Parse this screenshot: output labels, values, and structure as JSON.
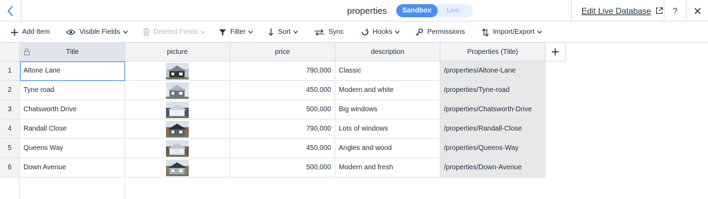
{
  "top_bar": {
    "collection_name": "properties",
    "mode_active": "Sandbox",
    "mode_inactive": "Live",
    "edit_live_label": "Edit Live Database",
    "help_label": "?"
  },
  "toolbar": {
    "add_item": "Add Item",
    "visible_fields": "Visible Fields",
    "deleted_fields": "Deleted Fields",
    "filter": "Filter",
    "sort": "Sort",
    "sync": "Sync",
    "hooks": "Hooks",
    "permissions": "Permissions",
    "import_export": "Import/Export"
  },
  "table": {
    "columns": [
      "Title",
      "picture",
      "price",
      "description",
      "Properties (Title)"
    ],
    "rows": [
      {
        "num": "1",
        "title": "Altone Lane",
        "thumb": "house-photo",
        "price": "790,000",
        "description": "Classic",
        "slug": "/properties/Altone-Lane"
      },
      {
        "num": "2",
        "title": "Tyne road",
        "thumb": "house-photo",
        "price": "450,000",
        "description": "Modern and white",
        "slug": "/properties/Tyne-road"
      },
      {
        "num": "3",
        "title": "Chatsworth Drive",
        "thumb": "house-photo",
        "price": "500,000",
        "description": "Big windows",
        "slug": "/properties/Chatsworth-Drive"
      },
      {
        "num": "4",
        "title": "Randall Close",
        "thumb": "house-photo",
        "price": "790,000",
        "description": "Lots of windows",
        "slug": "/properties/Randall-Close"
      },
      {
        "num": "5",
        "title": "Queens Way",
        "thumb": "house-photo",
        "price": "450,000",
        "description": "Angles and wood",
        "slug": "/properties/Queens-Way"
      },
      {
        "num": "6",
        "title": "Down Avenue",
        "thumb": "house-photo",
        "price": "500,000",
        "description": "Modern and fresh",
        "slug": "/properties/Down-Avenue"
      }
    ]
  },
  "colors": {
    "accent": "#4c8ff3",
    "header_bg": "#f2f3f5",
    "slug_bg": "#e8e8e9"
  }
}
